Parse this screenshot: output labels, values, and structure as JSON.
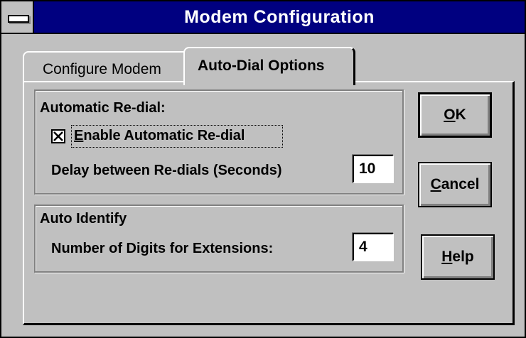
{
  "window": {
    "title": "Modem Configuration"
  },
  "tabs": [
    {
      "label": "Configure Modem",
      "active": false
    },
    {
      "label": "Auto-Dial Options",
      "active": true
    }
  ],
  "redial_group": {
    "heading": "Automatic Re-dial:",
    "enable_mnemonic": "E",
    "enable_rest": "nable Automatic Re-dial",
    "enable_checked": true,
    "delay_label": "Delay between Re-dials (Seconds)",
    "delay_value": "10"
  },
  "identify_group": {
    "heading": "Auto Identify",
    "digits_label": "Number of Digits for Extensions:",
    "digits_value": "4"
  },
  "buttons": {
    "ok_mnemonic": "O",
    "ok_rest": "K",
    "cancel_mnemonic": "C",
    "cancel_rest": "ancel",
    "help_mnemonic": "H",
    "help_rest": "elp"
  },
  "colors": {
    "face": "#c0c0c0",
    "titlebar": "#000080",
    "title_text": "#ffffff"
  }
}
